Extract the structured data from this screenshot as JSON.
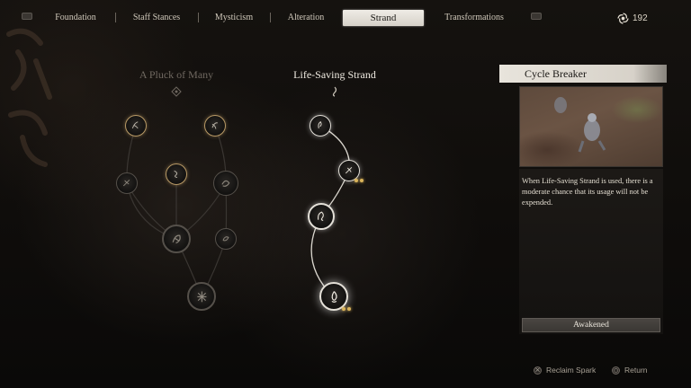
{
  "top_bar": {
    "tabs": [
      {
        "label": "Foundation"
      },
      {
        "label": "Staff Stances"
      },
      {
        "label": "Mysticism"
      },
      {
        "label": "Alteration"
      },
      {
        "label": "Strand",
        "active": true
      },
      {
        "label": "Transformations"
      }
    ],
    "left_shoulder_hint": "L1",
    "right_shoulder_hint": "R1",
    "spark_count": "192",
    "spark_icon": "spark-swirl-icon"
  },
  "trees": [
    {
      "title": "A Pluck of Many",
      "state": "inactive"
    },
    {
      "title": "Life-Saving Strand",
      "state": "selected"
    }
  ],
  "detail_panel": {
    "title": "Cycle Breaker",
    "description": "When Life-Saving Strand is used, there is a moderate chance that its usage will not be expended.",
    "status": "Awakened"
  },
  "footer_hints": [
    {
      "button": "⨉",
      "label": "Reclaim Spark"
    },
    {
      "button": "○",
      "label": "Return"
    }
  ],
  "colors": {
    "accent_gold": "#b99a66",
    "active_tab_bg": "#e8e4dc",
    "point_pip": "#d9b35a"
  }
}
